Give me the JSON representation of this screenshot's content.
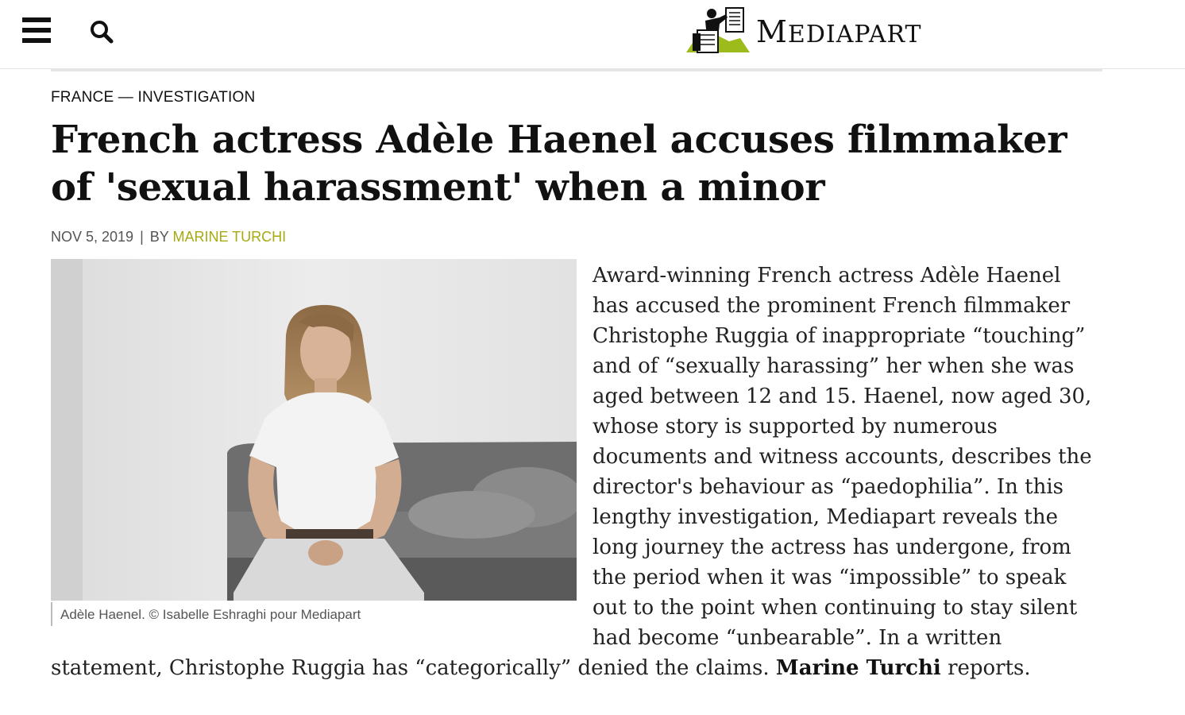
{
  "header": {
    "brand": "MEDIAPART",
    "brand_first": "M",
    "brand_rest": "EDIAPART"
  },
  "article": {
    "kicker": "FRANCE — INVESTIGATION",
    "headline": "French actress Adèle Haenel accuses filmmaker of 'sexual harassment' when a minor",
    "date": "NOV 5, 2019",
    "separator": "|",
    "by_label": "BY",
    "author": "MARINE TURCHI",
    "caption": "Adèle Haenel. © Isabelle Eshraghi pour Mediapart",
    "lead_text": "Award-winning French actress Adèle Haenel has accused the prominent French filmmaker Christophe Ruggia of inappropriate “touching” and of “sexually harassing” her when she was aged between 12 and 15. Haenel, now aged 30, whose story is supported by numerous documents and witness accounts, describes the director's behaviour as “paedophilia”. In this lengthy investigation, Mediapart reveals the long journey the actress has undergone, from the period when it was “impossible” to speak out to the point when continuing to stay silent had become “unbearable”. In a written statement, Christophe Ruggia has “categorically” denied the claims.",
    "lead_author": "Marine Turchi",
    "lead_end": "reports."
  },
  "icons": {
    "menu": "hamburger-menu-icon",
    "search": "search-icon",
    "logo": "mediapart-logo-icon"
  },
  "colors": {
    "author_link": "#a7aa10",
    "logo_green": "#9dbb1a",
    "text": "#111111"
  }
}
